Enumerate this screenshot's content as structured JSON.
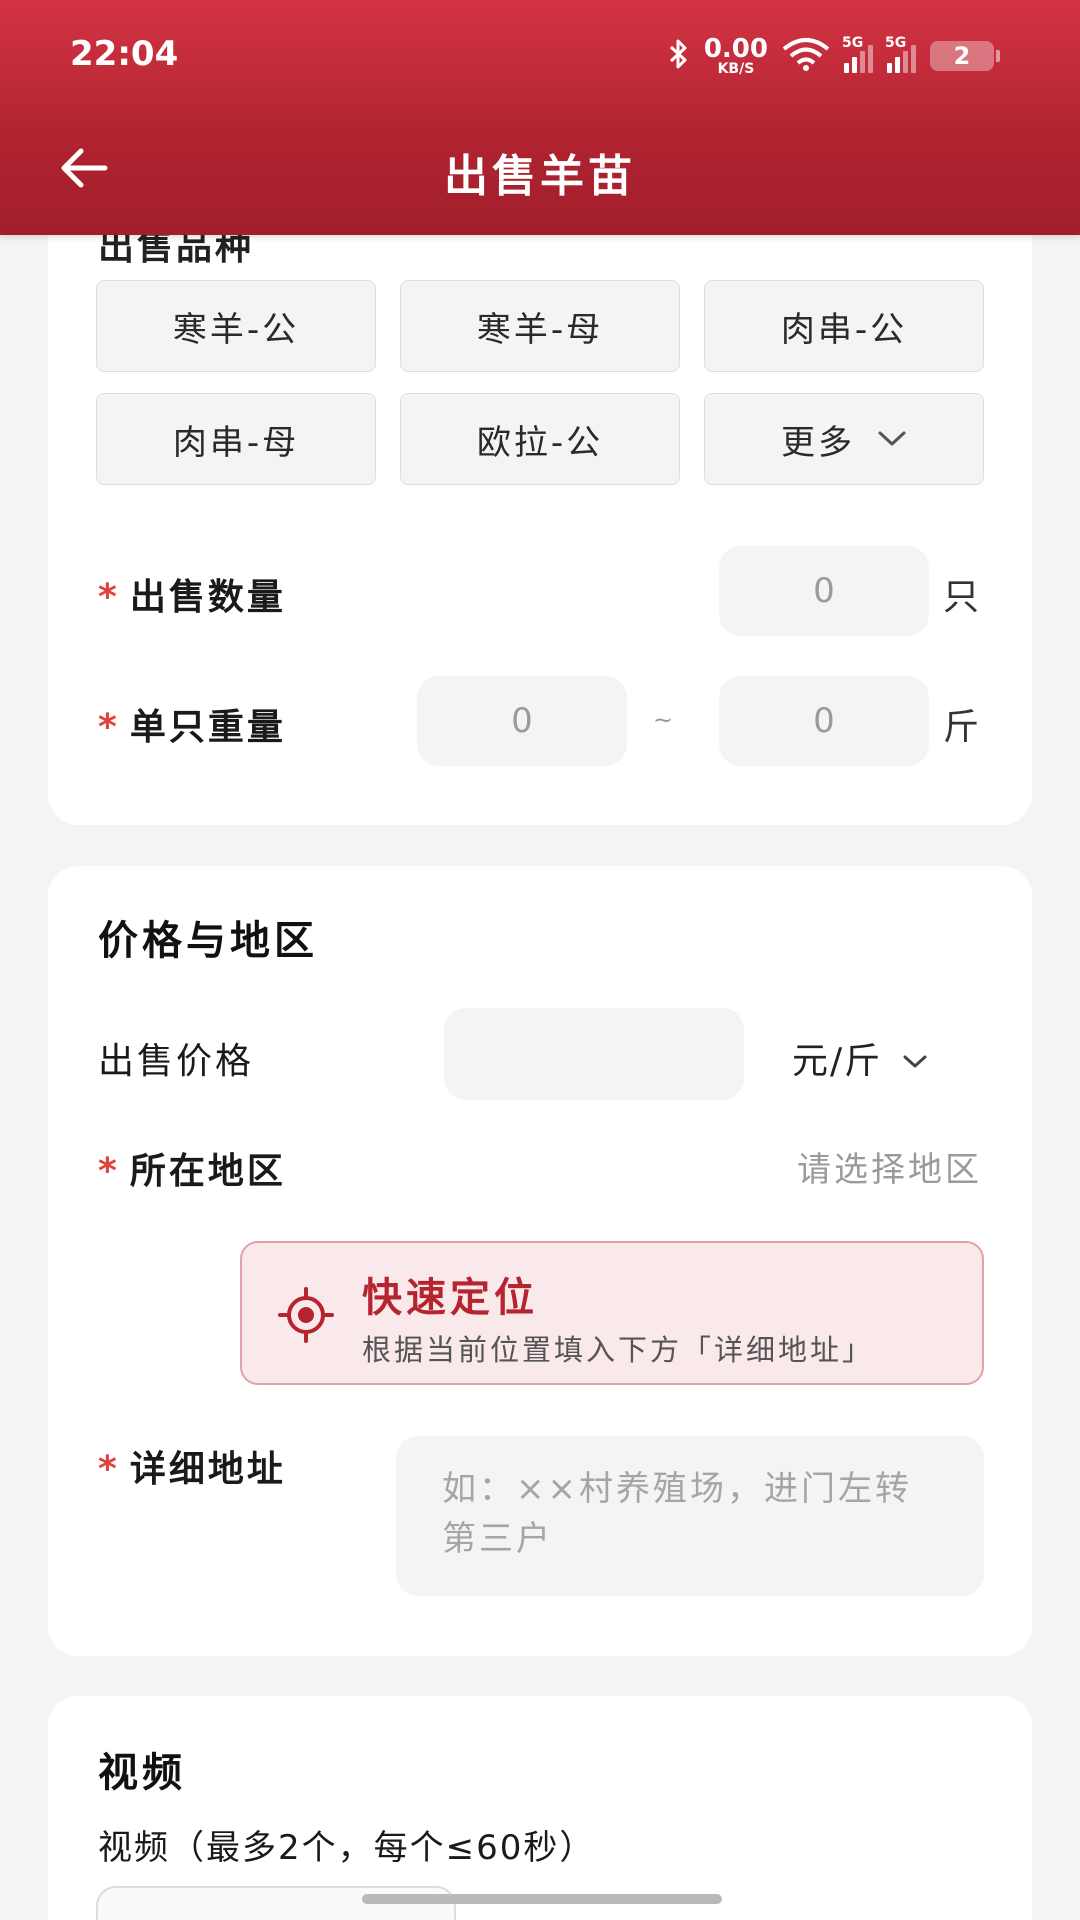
{
  "status_bar": {
    "time": "22:04",
    "net_speed_value": "0.00",
    "net_speed_unit": "KB/S",
    "signal1_label": "5G",
    "signal2_label": "5G",
    "battery": "2"
  },
  "header": {
    "title": "出售羊苗",
    "back_icon": "arrow-left-icon"
  },
  "breed_section": {
    "label_partial": "出售品种",
    "chips": [
      "寒羊-公",
      "寒羊-母",
      "肉串-公",
      "肉串-母",
      "欧拉-公"
    ],
    "more_label": "更多"
  },
  "quantity": {
    "required_mark": "*",
    "label": "出售数量",
    "value": "0",
    "unit": "只"
  },
  "weight": {
    "required_mark": "*",
    "label": "单只重量",
    "min": "0",
    "separator": "~",
    "max": "0",
    "unit": "斤"
  },
  "price_region": {
    "title": "价格与地区",
    "price_label": "出售价格",
    "price_value": "",
    "price_unit": "元/斤",
    "region_required_mark": "*",
    "region_label": "所在地区",
    "region_placeholder": "请选择地区",
    "locate_title": "快速定位",
    "locate_desc": "根据当前位置填入下方「详细地址」",
    "address_required_mark": "*",
    "address_label": "详细地址",
    "address_placeholder": "如：××村养殖场，进门左转第三户"
  },
  "video": {
    "title": "视频",
    "subtitle": "视频（最多2个，每个≤60秒）"
  },
  "colors": {
    "header_red": "#b22432",
    "required_red": "#e0413a",
    "locate_red": "#b6252f"
  }
}
